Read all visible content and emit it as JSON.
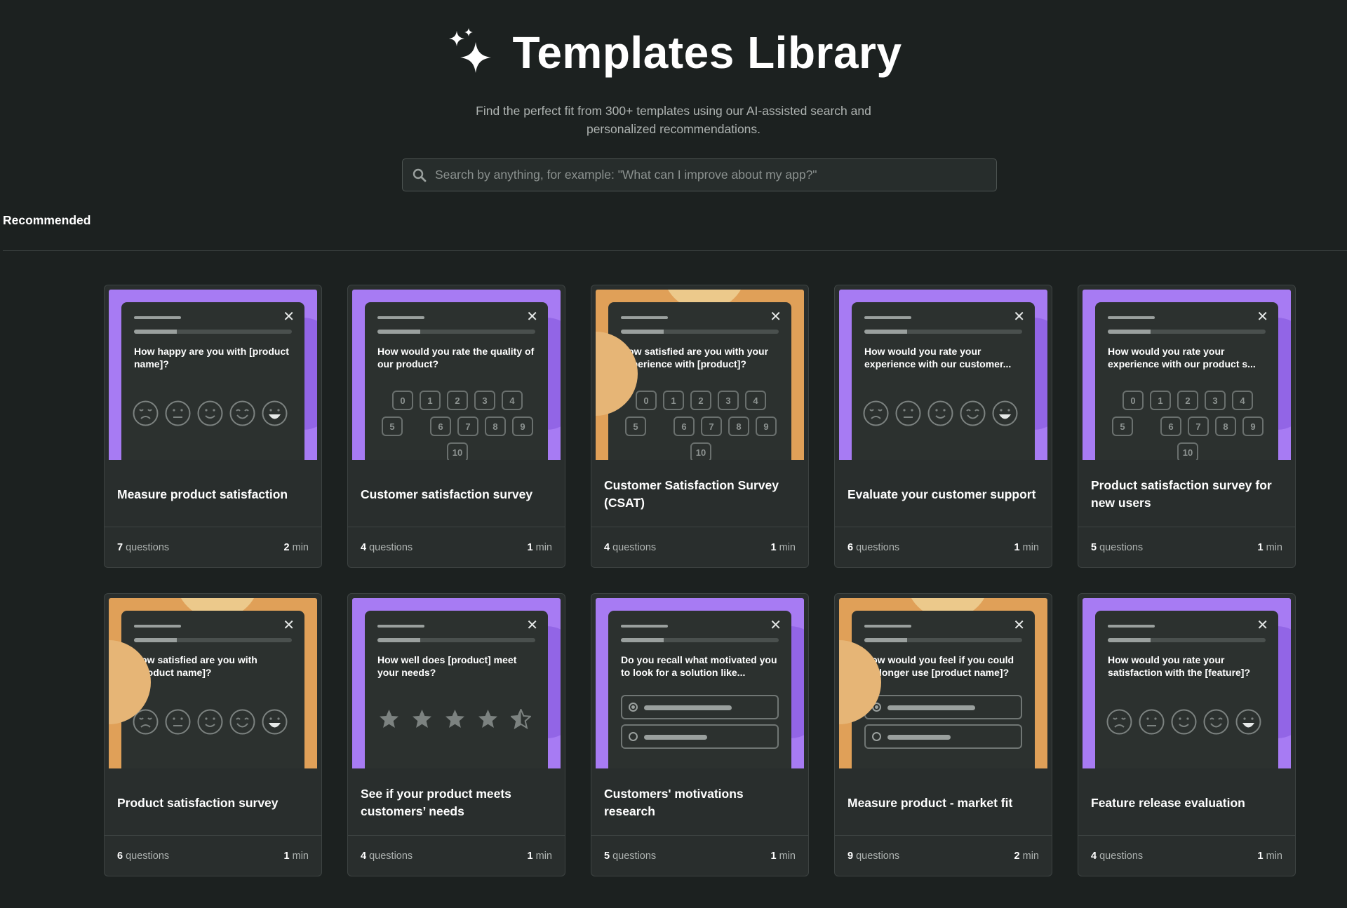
{
  "header": {
    "title": "Templates Library",
    "subtitle": "Find the perfect fit from 300+ templates using our AI-assisted search and personalized recommendations.",
    "sparkle_icon": "sparkle-icon"
  },
  "search": {
    "placeholder": "Search by anything, for example: \"What can I improve about my app?\"",
    "value": ""
  },
  "section": {
    "label": "Recommended"
  },
  "colors": {
    "background": "#1c2120",
    "purple": "#a77bf3",
    "orange": "#e0a058",
    "card": "#292e2d"
  },
  "cards": [
    {
      "theme": "purple",
      "type": "faces",
      "question": "How happy are you with [product name]?",
      "title": "Measure product satisfaction",
      "questions": "7",
      "questions_label": "questions",
      "duration": "2",
      "duration_label": "min"
    },
    {
      "theme": "purple",
      "type": "numbers",
      "question": "How would you rate the quality of our product?",
      "title": "Customer satisfaction survey",
      "questions": "4",
      "questions_label": "questions",
      "duration": "1",
      "duration_label": "min"
    },
    {
      "theme": "orange",
      "type": "numbers",
      "question": "How satisfied are you with your experience with [product]?",
      "title": "Customer Satisfaction Survey (CSAT)",
      "questions": "4",
      "questions_label": "questions",
      "duration": "1",
      "duration_label": "min"
    },
    {
      "theme": "purple",
      "type": "faces",
      "question": "How would you rate your experience with our customer...",
      "title": "Evaluate your customer support",
      "questions": "6",
      "questions_label": "questions",
      "duration": "1",
      "duration_label": "min"
    },
    {
      "theme": "purple",
      "type": "numbers",
      "question": "How would you rate your experience with our product s...",
      "title": "Product satisfaction survey for new users",
      "questions": "5",
      "questions_label": "questions",
      "duration": "1",
      "duration_label": "min"
    },
    {
      "theme": "orange",
      "type": "faces",
      "question": "How satisfied are you with [product name]?",
      "title": "Product satisfaction survey",
      "questions": "6",
      "questions_label": "questions",
      "duration": "1",
      "duration_label": "min"
    },
    {
      "theme": "purple",
      "type": "stars",
      "question": "How well does [product] meet your needs?",
      "title": "See if your product meets customers’ needs",
      "questions": "4",
      "questions_label": "questions",
      "duration": "1",
      "duration_label": "min"
    },
    {
      "theme": "purple",
      "type": "options",
      "question": "Do you recall what motivated you to look for a solution like...",
      "title": "Customers' motivations research",
      "questions": "5",
      "questions_label": "questions",
      "duration": "1",
      "duration_label": "min"
    },
    {
      "theme": "orange",
      "type": "options",
      "question": "How would you feel if you could no longer use [product name]?",
      "title": "Measure product - market fit",
      "questions": "9",
      "questions_label": "questions",
      "duration": "2",
      "duration_label": "min"
    },
    {
      "theme": "purple",
      "type": "faces",
      "question": "How would you rate your satisfaction with the [feature]?",
      "title": "Feature release evaluation",
      "questions": "4",
      "questions_label": "questions",
      "duration": "1",
      "duration_label": "min"
    }
  ],
  "rating_numbers": [
    "0",
    "1",
    "2",
    "3",
    "4",
    "5",
    "6",
    "7",
    "8",
    "9",
    "10"
  ],
  "close_glyph": "✕"
}
